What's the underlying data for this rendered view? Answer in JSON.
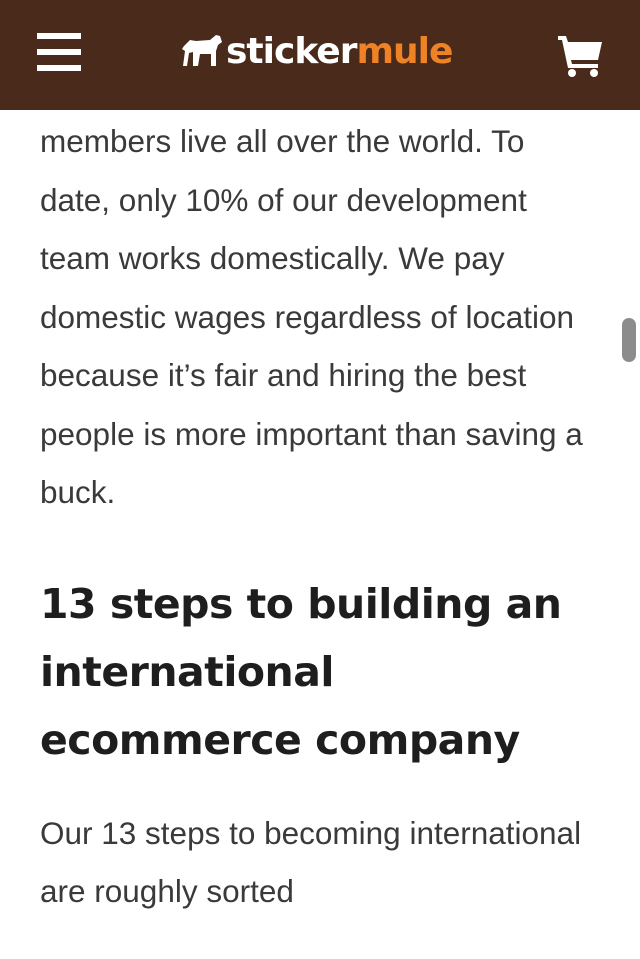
{
  "header": {
    "logo_sticker": "sticker",
    "logo_mule": "mule",
    "menu_icon": "hamburger-menu-icon",
    "cart_icon": "shopping-cart-icon",
    "background_color": "#4a2a1b",
    "accent_color": "#f08226"
  },
  "article": {
    "paragraph_1": "members live all over the world. To date, only 10% of our development team works domestically. We pay domestic wages regardless of location because it’s fair and hiring the best people is more important than saving a buck.",
    "heading": "13 steps to building an international ecommerce company",
    "paragraph_2": "Our 13 steps to becoming international are roughly sorted"
  }
}
